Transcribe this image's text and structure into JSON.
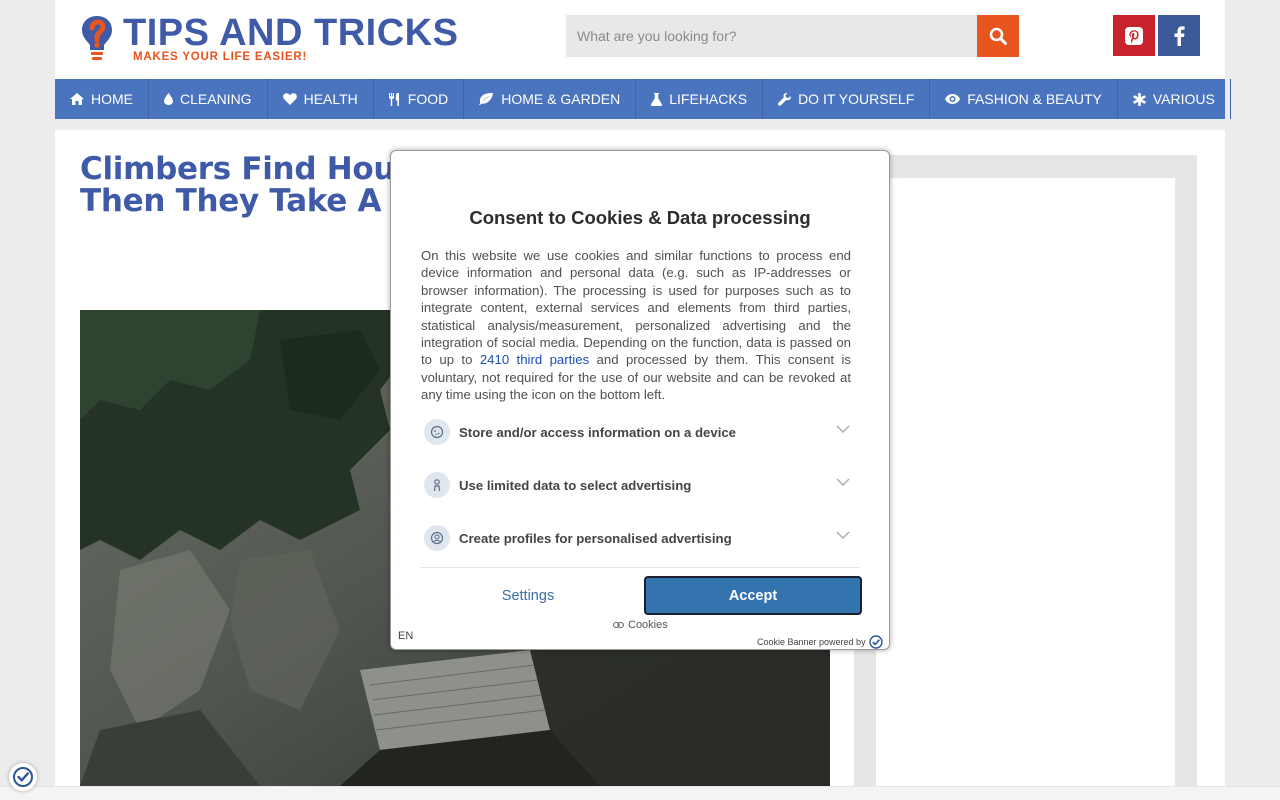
{
  "header": {
    "logo_title": "TIPS AND TRICKS",
    "logo_tagline": "MAKES YOUR LIFE EASIER!",
    "search_placeholder": "What are you looking for?",
    "social": [
      "pinterest-icon",
      "facebook-icon"
    ],
    "colors": {
      "brand_blue": "#3f5ba7",
      "accent_orange": "#e8541e",
      "nav_bg": "#4a74be",
      "pinterest": "#c8232c",
      "facebook": "#3b5998"
    }
  },
  "nav": {
    "items": [
      {
        "label": "HOME",
        "icon": "home-icon"
      },
      {
        "label": "CLEANING",
        "icon": "drop-icon"
      },
      {
        "label": "HEALTH",
        "icon": "heart-icon"
      },
      {
        "label": "FOOD",
        "icon": "cutlery-icon"
      },
      {
        "label": "HOME & GARDEN",
        "icon": "leaf-icon"
      },
      {
        "label": "LIFEHACKS",
        "icon": "flask-icon"
      },
      {
        "label": "DO IT YOURSELF",
        "icon": "wrench-icon"
      },
      {
        "label": "FASHION & BEAUTY",
        "icon": "eye-icon"
      },
      {
        "label": "VARIOUS",
        "icon": "asterisk-icon"
      }
    ]
  },
  "article": {
    "title_line1": "Climbers Find Hous",
    "title_line2": "Then They Take A Lo"
  },
  "consent": {
    "title": "Consent to Cookies & Data processing",
    "body_before_link": "On this website we use cookies and similar functions to process end device information and personal data (e.g. such as IP-addresses or browser information). The processing is used for purposes such as to integrate content, external services and elements from third parties, statistical analysis/measurement, personalized advertising and the integration of social media. Depending on the function, data is passed on to up to ",
    "link_text": "2410 third parties",
    "body_after_link": " and processed by them. This consent is voluntary, not required for the use of our website and can be revoked at any time using the icon on the bottom left.",
    "purposes": [
      {
        "label": "Store and/or access information on a device",
        "icon": "cookie-icon"
      },
      {
        "label": "Use limited data to select advertising",
        "icon": "person-icon"
      },
      {
        "label": "Create profiles for personalised advertising",
        "icon": "profile-icon"
      }
    ],
    "settings_label": "Settings",
    "accept_label": "Accept",
    "cookies_label": "Cookies",
    "language": "EN",
    "powered_by": "Cookie Banner powered by",
    "accent": "#3373ae"
  }
}
